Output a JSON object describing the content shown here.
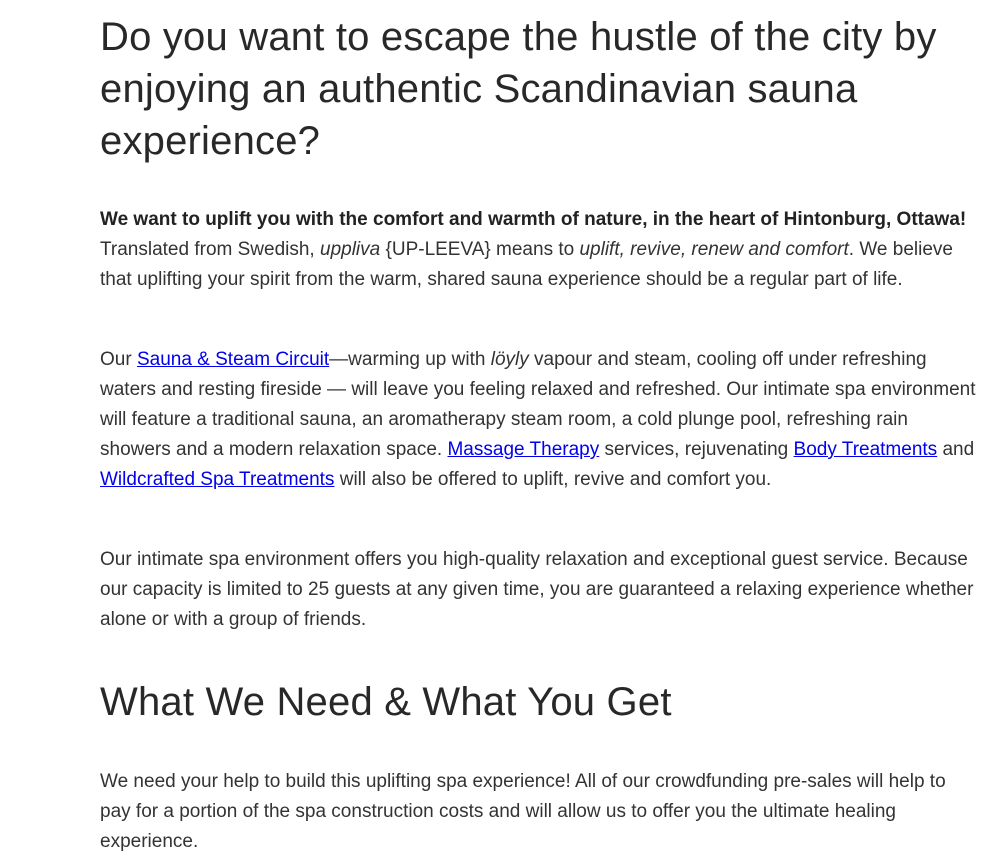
{
  "heading_intro": "Do you want to escape the hustle of the city by enjoying an authentic Scandinavian sauna experience?",
  "para1": {
    "bold": "We want to uplift you with the comfort and warmth of nature, in the heart of Hintonburg, Ottawa!",
    "t1": " Translated from Swedish, ",
    "em1": "uppliva",
    "t2": " {UP-LEEVA} means to ",
    "em2": "uplift, revive, renew and comfort",
    "t3": ". We believe that uplifting your spirit from the warm, shared sauna experience should be a regular part of life."
  },
  "para2": {
    "t1": "Our ",
    "link_sauna": "Sauna & Steam Circuit",
    "t2": "—warming up with ",
    "em_loyly": "löyly",
    "t3": " vapour and steam, cooling off under refreshing waters and resting fireside — will leave you feeling relaxed and refreshed. Our intimate spa environment will feature a traditional sauna, an aromatherapy steam room, a cold plunge pool, refreshing rain showers and a modern relaxation space. ",
    "link_massage": "Massage Therapy",
    "t4": " services, rejuvenating ",
    "link_body": "Body Treatments",
    "t5": " and ",
    "link_wild": "Wildcrafted Spa Treatments",
    "t6": " will also be offered to uplift, revive and comfort you."
  },
  "para3": "Our intimate spa environment offers you high-quality relaxation and exceptional guest service. Because our capacity is limited to 25 guests at any given time, you are guaranteed a relaxing experience whether alone or with a group of friends.",
  "heading_section": "What We Need & What You Get",
  "para4": "We need your help to build this uplifting spa experience! All of our crowdfunding pre-sales will help to pay for a portion of the spa construction costs and will allow us to offer you the ultimate healing experience."
}
